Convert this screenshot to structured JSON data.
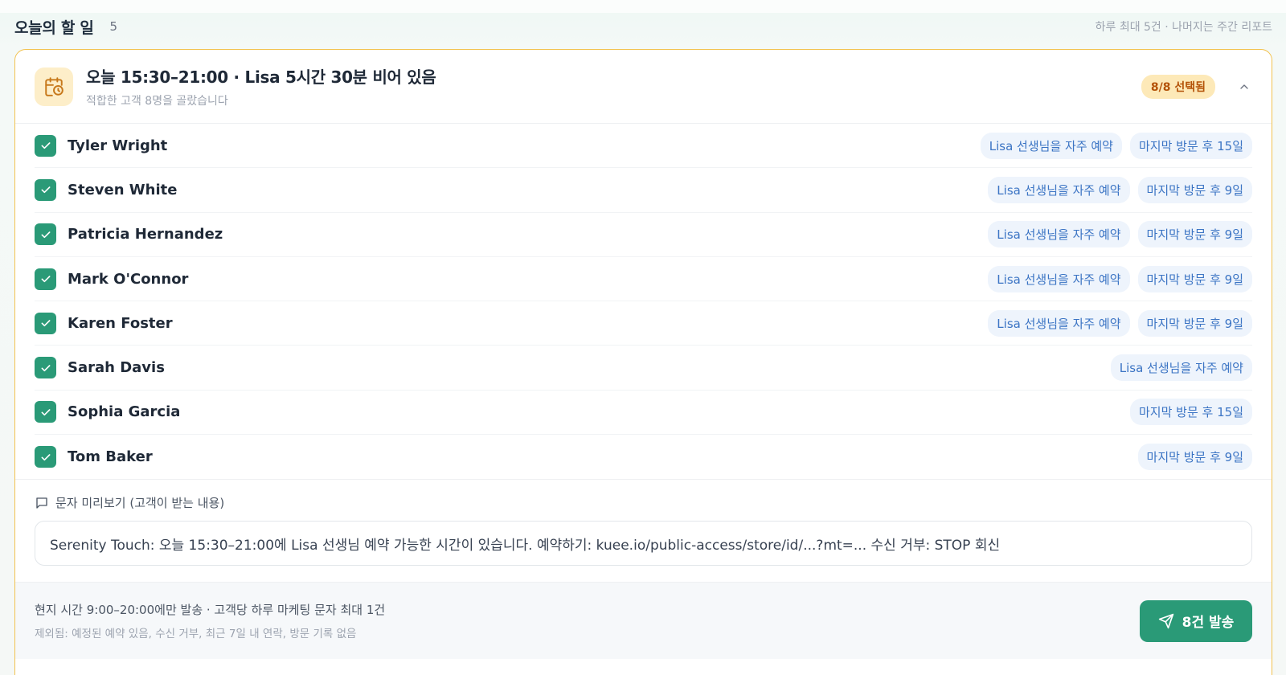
{
  "header": {
    "title": "오늘의 할 일",
    "count": "5",
    "note": "하루 최대 5건 · 나머지는 주간 리포트"
  },
  "card": {
    "title": "오늘 15:30–21:00 · Lisa 5시간 30분 비어 있음",
    "subtitle": "적합한 고객 8명을 골랐습니다",
    "selected_badge": "8/8 선택됨",
    "icon": "calendar-clock-icon",
    "accent_color": "#f2c24f"
  },
  "customers": [
    {
      "name": "Tyler Wright",
      "checked": true,
      "tags": [
        "Lisa 선생님을 자주 예약",
        "마지막 방문 후 15일"
      ]
    },
    {
      "name": "Steven White",
      "checked": true,
      "tags": [
        "Lisa 선생님을 자주 예약",
        "마지막 방문 후 9일"
      ]
    },
    {
      "name": "Patricia Hernandez",
      "checked": true,
      "tags": [
        "Lisa 선생님을 자주 예약",
        "마지막 방문 후 9일"
      ]
    },
    {
      "name": "Mark O'Connor",
      "checked": true,
      "tags": [
        "Lisa 선생님을 자주 예약",
        "마지막 방문 후 9일"
      ]
    },
    {
      "name": "Karen Foster",
      "checked": true,
      "tags": [
        "Lisa 선생님을 자주 예약",
        "마지막 방문 후 9일"
      ]
    },
    {
      "name": "Sarah Davis",
      "checked": true,
      "tags": [
        "Lisa 선생님을 자주 예약"
      ]
    },
    {
      "name": "Sophia Garcia",
      "checked": true,
      "tags": [
        "마지막 방문 후 15일"
      ]
    },
    {
      "name": "Tom Baker",
      "checked": true,
      "tags": [
        "마지막 방문 후 9일"
      ]
    }
  ],
  "preview": {
    "label": "문자 미리보기 (고객이 받는 내용)",
    "message": "Serenity Touch: 오늘 15:30–21:00에 Lisa 선생님 예약 가능한 시간이 있습니다. 예약하기: kuee.io/public-access/store/id/...?mt=... 수신 거부: STOP 회신"
  },
  "footer": {
    "rule": "현지 시간 9:00–20:00에만 발송 · 고객당 하루 마케팅 문자 최대 1건",
    "excluded": "제외됨: 예정된 예약 있음, 수신 거부, 최근 7일 내 연락, 방문 기록 없음",
    "send_label": "8건 발송",
    "send_color": "#2a9a77"
  }
}
